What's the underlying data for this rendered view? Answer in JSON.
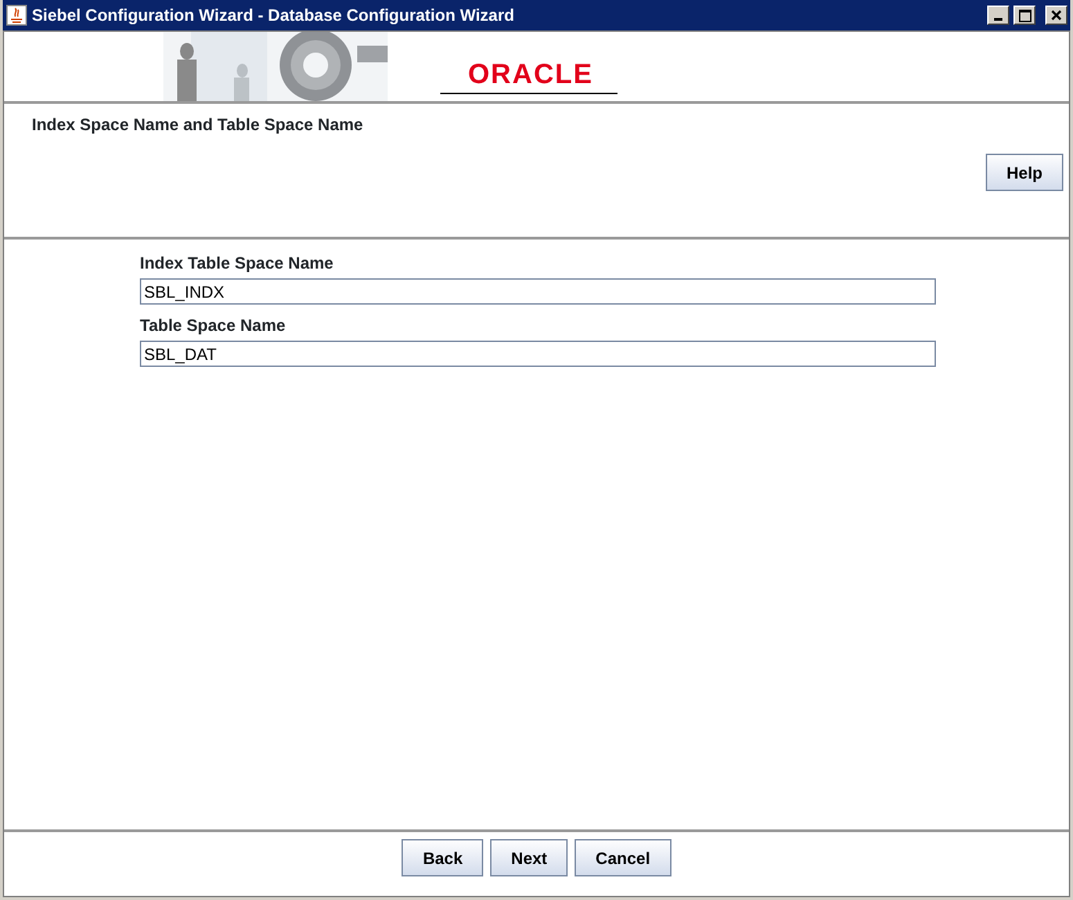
{
  "window": {
    "title": "Siebel Configuration Wizard - Database Configuration Wizard"
  },
  "banner": {
    "logo": "ORACLE",
    "kind": "picture"
  },
  "header": {
    "title": "Index Space Name and Table Space Name",
    "help_button": "Help"
  },
  "fields": [
    {
      "label": "Index Table Space Name",
      "value": "SBL_INDX"
    },
    {
      "label": "Table Space Name",
      "value": "SBL_DAT"
    }
  ],
  "buttons": [
    "Back",
    "Next",
    "Cancel"
  ]
}
